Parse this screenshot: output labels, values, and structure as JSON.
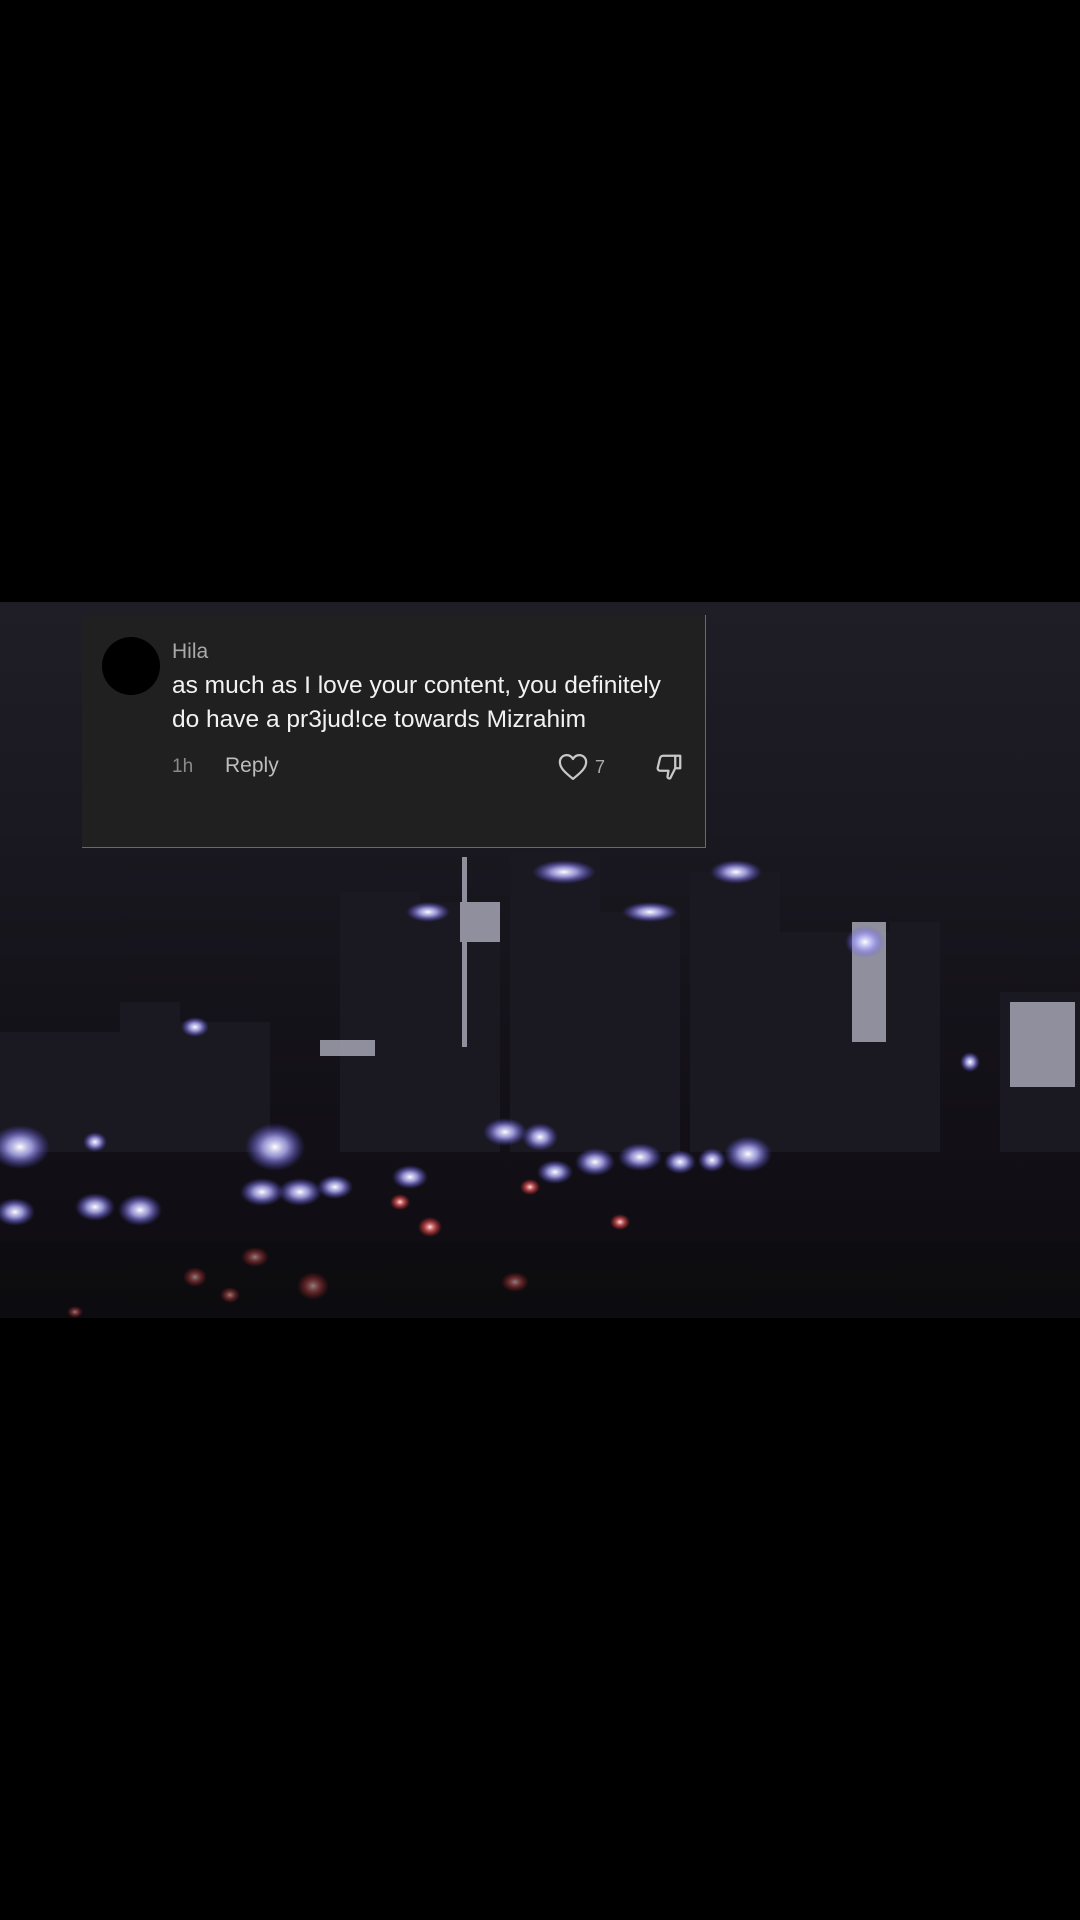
{
  "comment": {
    "username": "Hila",
    "text": "as much as I love your content, you definitely do have a pr3jud!ce towards Mizrahim",
    "time": "1h",
    "reply_label": "Reply",
    "like_count": "7",
    "icons": {
      "like": "heart-outline-icon",
      "dislike": "thumbs-down-icon"
    }
  },
  "colors": {
    "card_bg": "#202020",
    "text_primary": "#f2f2f2",
    "text_secondary": "#a9a9a9"
  }
}
